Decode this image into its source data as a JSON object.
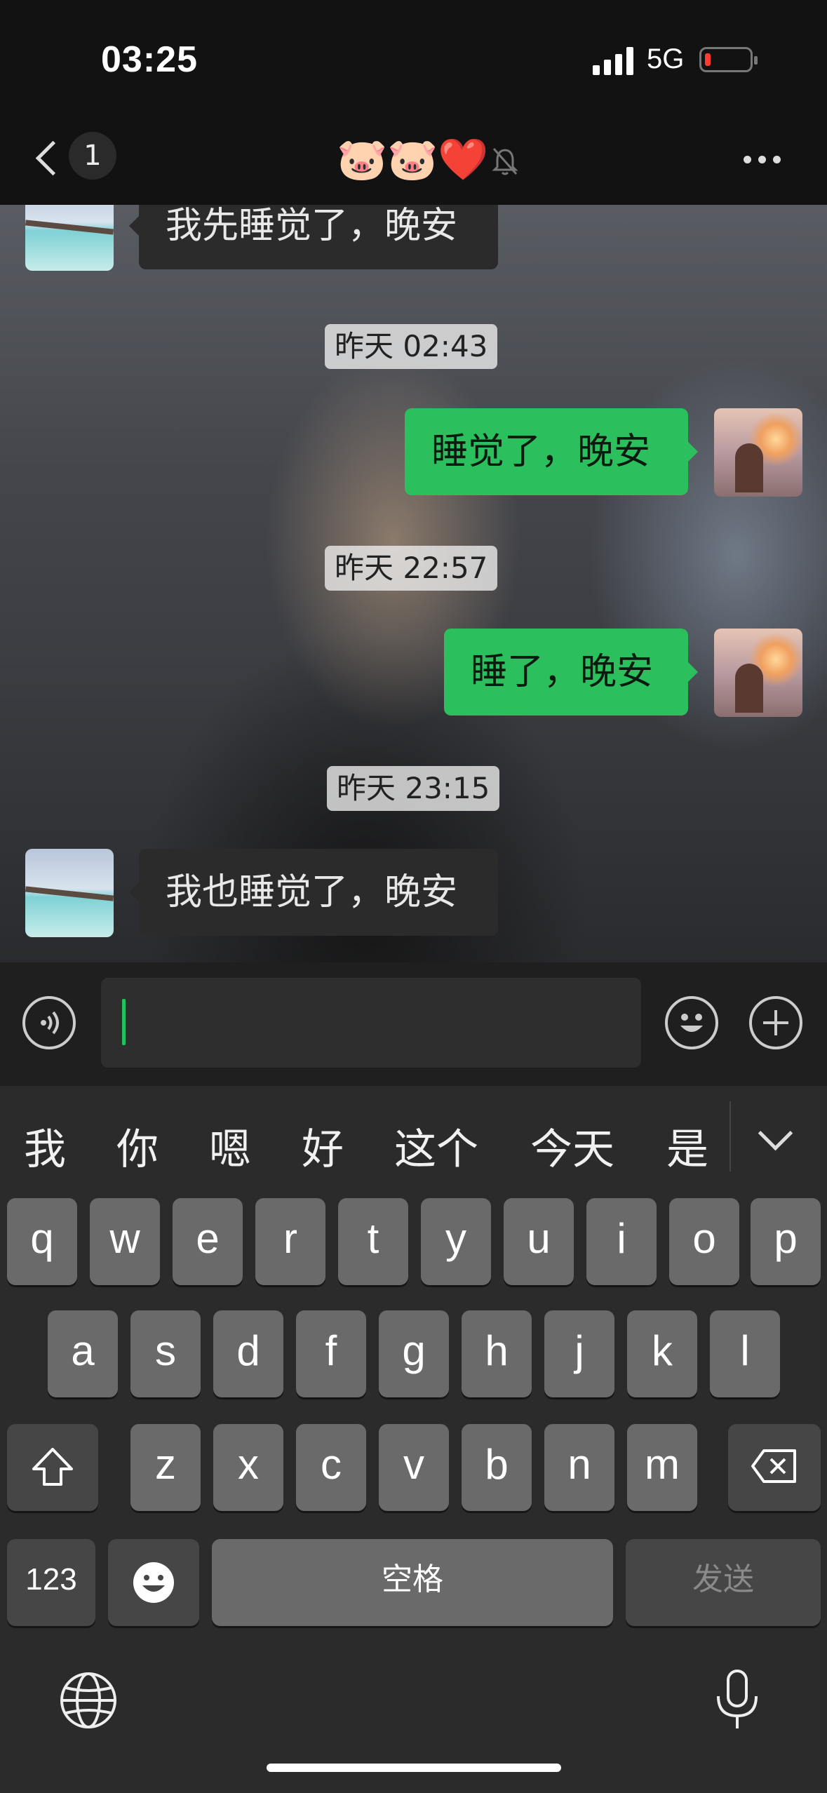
{
  "status_bar": {
    "time": "03:25",
    "network": "5G",
    "battery_color": "#ff3b30"
  },
  "nav": {
    "unread_count": "1",
    "title": "🐷🐷❤️"
  },
  "messages": {
    "m1": "我先睡觉了，晚安",
    "t1": "昨天 02:43",
    "m2": "睡觉了，晚安",
    "t2": "昨天 22:57",
    "m3": "睡了，晚安",
    "t3": "昨天 23:15",
    "m4": "我也睡觉了，晚安"
  },
  "input": {
    "value": ""
  },
  "keyboard": {
    "candidates": [
      "我",
      "你",
      "嗯",
      "好",
      "这个",
      "今天",
      "是"
    ],
    "row1": [
      "q",
      "w",
      "e",
      "r",
      "t",
      "y",
      "u",
      "i",
      "o",
      "p"
    ],
    "row2": [
      "a",
      "s",
      "d",
      "f",
      "g",
      "h",
      "j",
      "k",
      "l"
    ],
    "row3": [
      "z",
      "x",
      "c",
      "v",
      "b",
      "n",
      "m"
    ],
    "numbers_key": "123",
    "space_key": "空格",
    "send_key": "发送"
  },
  "colors": {
    "accent_green": "#2cbf5e",
    "caret": "#1fc25c"
  }
}
